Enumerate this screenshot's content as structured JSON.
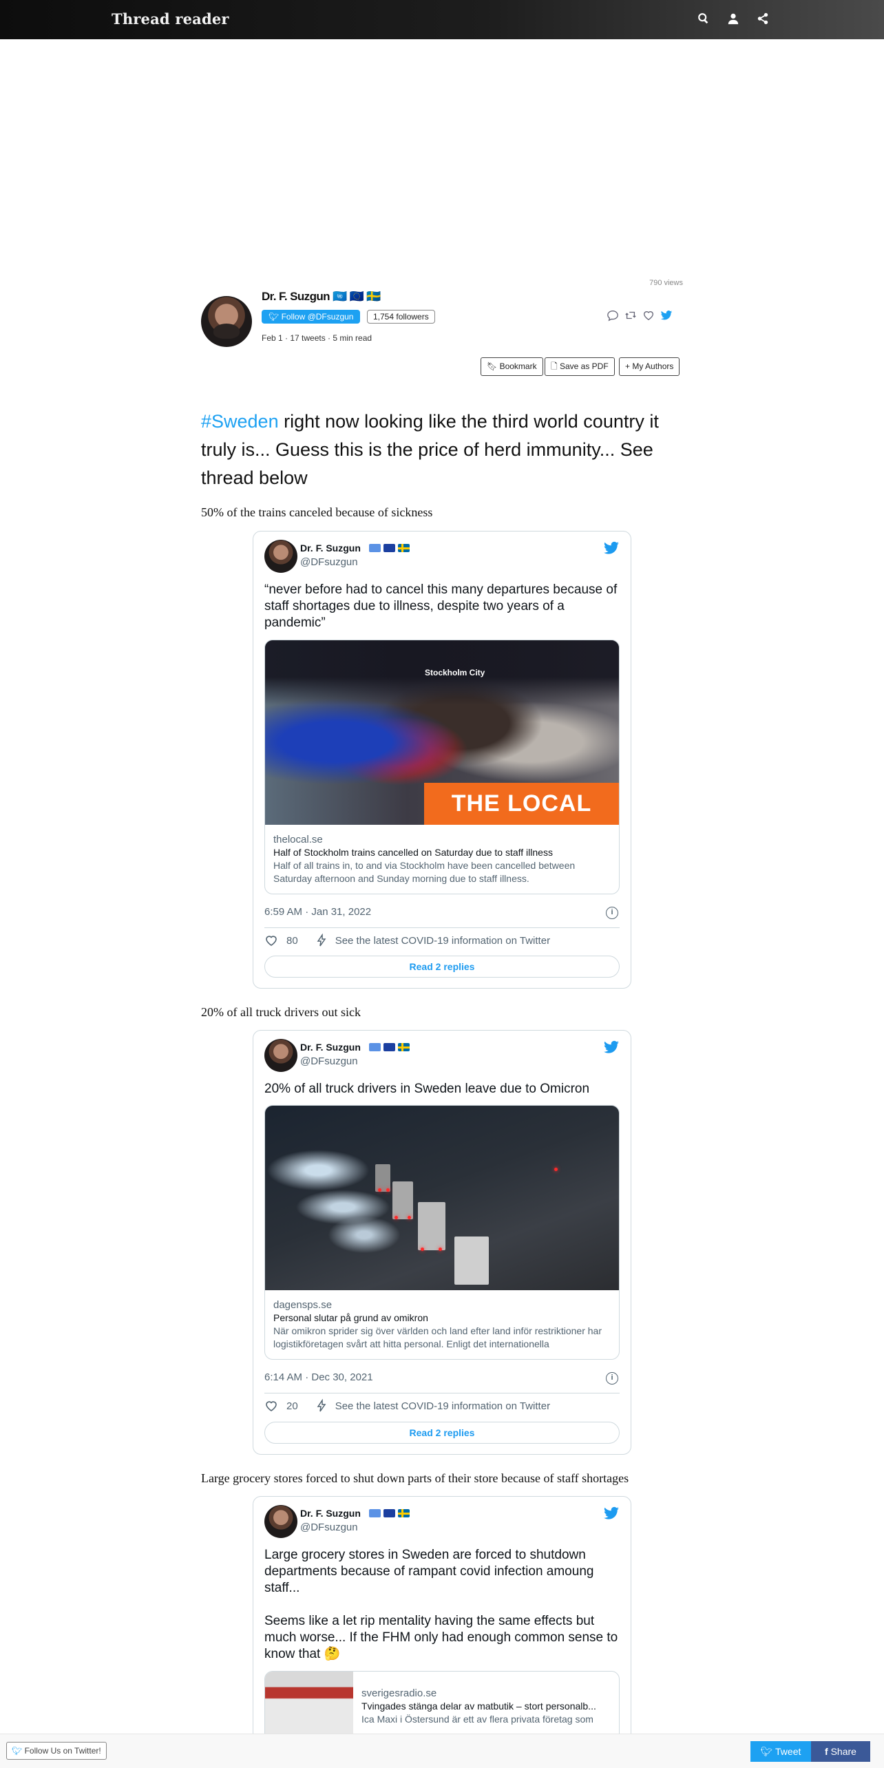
{
  "header": {
    "brand": "Thread reader",
    "icons": [
      "search-icon",
      "user-icon",
      "share-icon"
    ]
  },
  "thread": {
    "views": "790 views",
    "author_name": "Dr. F. Suzgun 🇺🇳 🇪🇺 🇸🇪",
    "follow_label": "Follow @DFsuzgun",
    "followers": "1,754 followers",
    "meta": "Feb 1 · 17 tweets · 5 min read",
    "buttons": {
      "bookmark": "Bookmark",
      "pdf": "Save as PDF",
      "authors": "My Authors"
    },
    "lead_hashtag": "#Sweden",
    "lead_text": " right now looking like the third world country it truly is... Guess this is the price of herd immunity... See thread below",
    "paragraphs": [
      "50% of the trains canceled because of sickness",
      "20% of all truck drivers out sick",
      "Large grocery stores forced to shut down parts of their store because of staff shortages"
    ]
  },
  "tweets": [
    {
      "name": "Dr. F. Suzgun",
      "handle": "@DFsuzgun",
      "text": "“never before had to cancel this many departures because of staff shortages due to illness, despite two years of a pandemic”",
      "image_sign": "Stockholm City",
      "image_badge": "THE LOCAL",
      "domain": "thelocal.se",
      "title": "Half of Stockholm trains cancelled on Saturday due to staff illness",
      "desc": "Half of all trains in, to and via Stockholm have been cancelled between Saturday afternoon and Sunday morning due to staff illness.",
      "date": "6:59 AM · Jan 31, 2022",
      "likes": "80",
      "covid": "See the latest COVID-19 information on Twitter",
      "replies": "Read 2 replies"
    },
    {
      "name": "Dr. F. Suzgun",
      "handle": "@DFsuzgun",
      "text": "20% of all truck drivers in Sweden leave due to Omicron",
      "domain": "dagensps.se",
      "title": "Personal slutar på grund av omikron",
      "desc": "När omikron sprider sig över världen och land efter land inför restriktioner har logistikföretagen svårt att hitta personal. Enligt det internationella",
      "date": "6:14 AM · Dec 30, 2021",
      "likes": "20",
      "covid": "See the latest COVID-19 information on Twitter",
      "replies": "Read 2 replies"
    },
    {
      "name": "Dr. F. Suzgun",
      "handle": "@DFsuzgun",
      "text1": "Large grocery stores in Sweden are forced to shutdown departments because of rampant covid infection amoung staff...",
      "text2": "Seems like a let rip mentality having the same effects but much worse... If the FHM only had enough common sense to know that 🤔",
      "domain": "sverigesradio.se",
      "title": "Tvingades stänga delar av matbutik – stort personalb...",
      "desc": "Ica Maxi i Östersund är ett av flera privata företag som"
    }
  ],
  "footer": {
    "follow_us": "Follow Us on Twitter!",
    "tweet": "Tweet",
    "share": "Share"
  },
  "colors": {
    "twitter_blue": "#1da1f2",
    "facebook_blue": "#3b5998",
    "local_orange": "#f26b1d"
  }
}
